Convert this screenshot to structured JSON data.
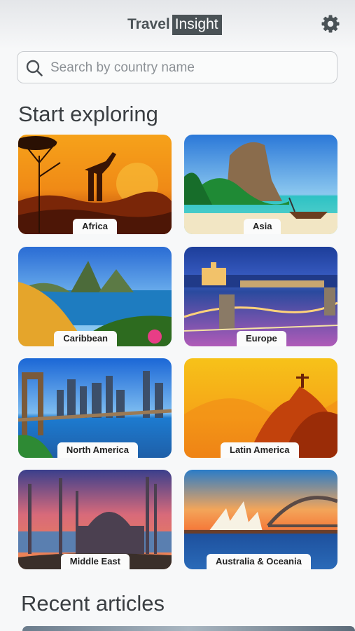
{
  "app": {
    "logo_part1": "Travel",
    "logo_part2": "Insight"
  },
  "header": {
    "settings_icon": "gear-icon"
  },
  "search": {
    "placeholder": "Search by country name",
    "value": "",
    "icon": "search-icon"
  },
  "sections": {
    "explore_title": "Start exploring",
    "articles_title": "Recent articles"
  },
  "regions": [
    {
      "label": "Africa"
    },
    {
      "label": "Asia"
    },
    {
      "label": "Caribbean"
    },
    {
      "label": "Europe"
    },
    {
      "label": "North America"
    },
    {
      "label": "Latin America"
    },
    {
      "label": "Middle East"
    },
    {
      "label": "Australia & Oceania"
    }
  ],
  "colors": {
    "accent": "#4a5256",
    "background": "#f7f8f9"
  }
}
